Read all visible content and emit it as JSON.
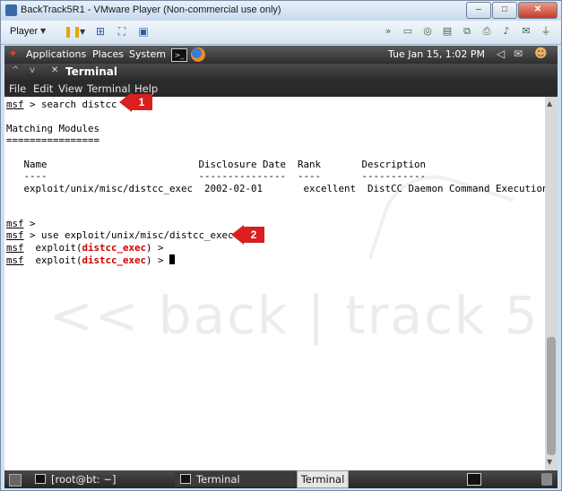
{
  "vm": {
    "title": "BackTrack5R1 - VMware Player (Non-commercial use only)",
    "controls": {
      "minimize": "–",
      "maximize": "□",
      "close": "✕"
    },
    "toolbar": {
      "player_menu": "Player"
    }
  },
  "gnome_panel": {
    "menus": [
      "Applications",
      "Places",
      "System"
    ],
    "clock": "Tue Jan 15,  1:02 PM"
  },
  "terminal": {
    "title": "Terminal",
    "menu": [
      "File",
      "Edit",
      "View",
      "Terminal",
      "Help"
    ],
    "lines": {
      "l1_cmd": " > search distcc",
      "l3": "Matching Modules",
      "l4": "================",
      "l6": "   Name                          Disclosure Date  Rank       Description",
      "l7": "   ----                          ---------------  ----       -----------",
      "l8": "   exploit/unix/misc/distcc_exec  2002-02-01       excellent  DistCC Daemon Command Execution",
      "l10": " >",
      "l11": " > use exploit/unix/misc/distcc_exec",
      "l12_pre": "  exploit(",
      "l12_mod": "distcc_exec",
      "l12_post": ") >",
      "l13_pre": "  exploit(",
      "l13_mod": "distcc_exec",
      "l13_post": ") > "
    },
    "prompt": "msf",
    "watermark": "<< back | track 5"
  },
  "taskbar": {
    "root_task": "[root@bt: ~]",
    "terminal_task": "Terminal",
    "tooltip": "Terminal"
  },
  "callouts": {
    "c1": "1",
    "c2": "2",
    "color": "#d91f1f"
  }
}
